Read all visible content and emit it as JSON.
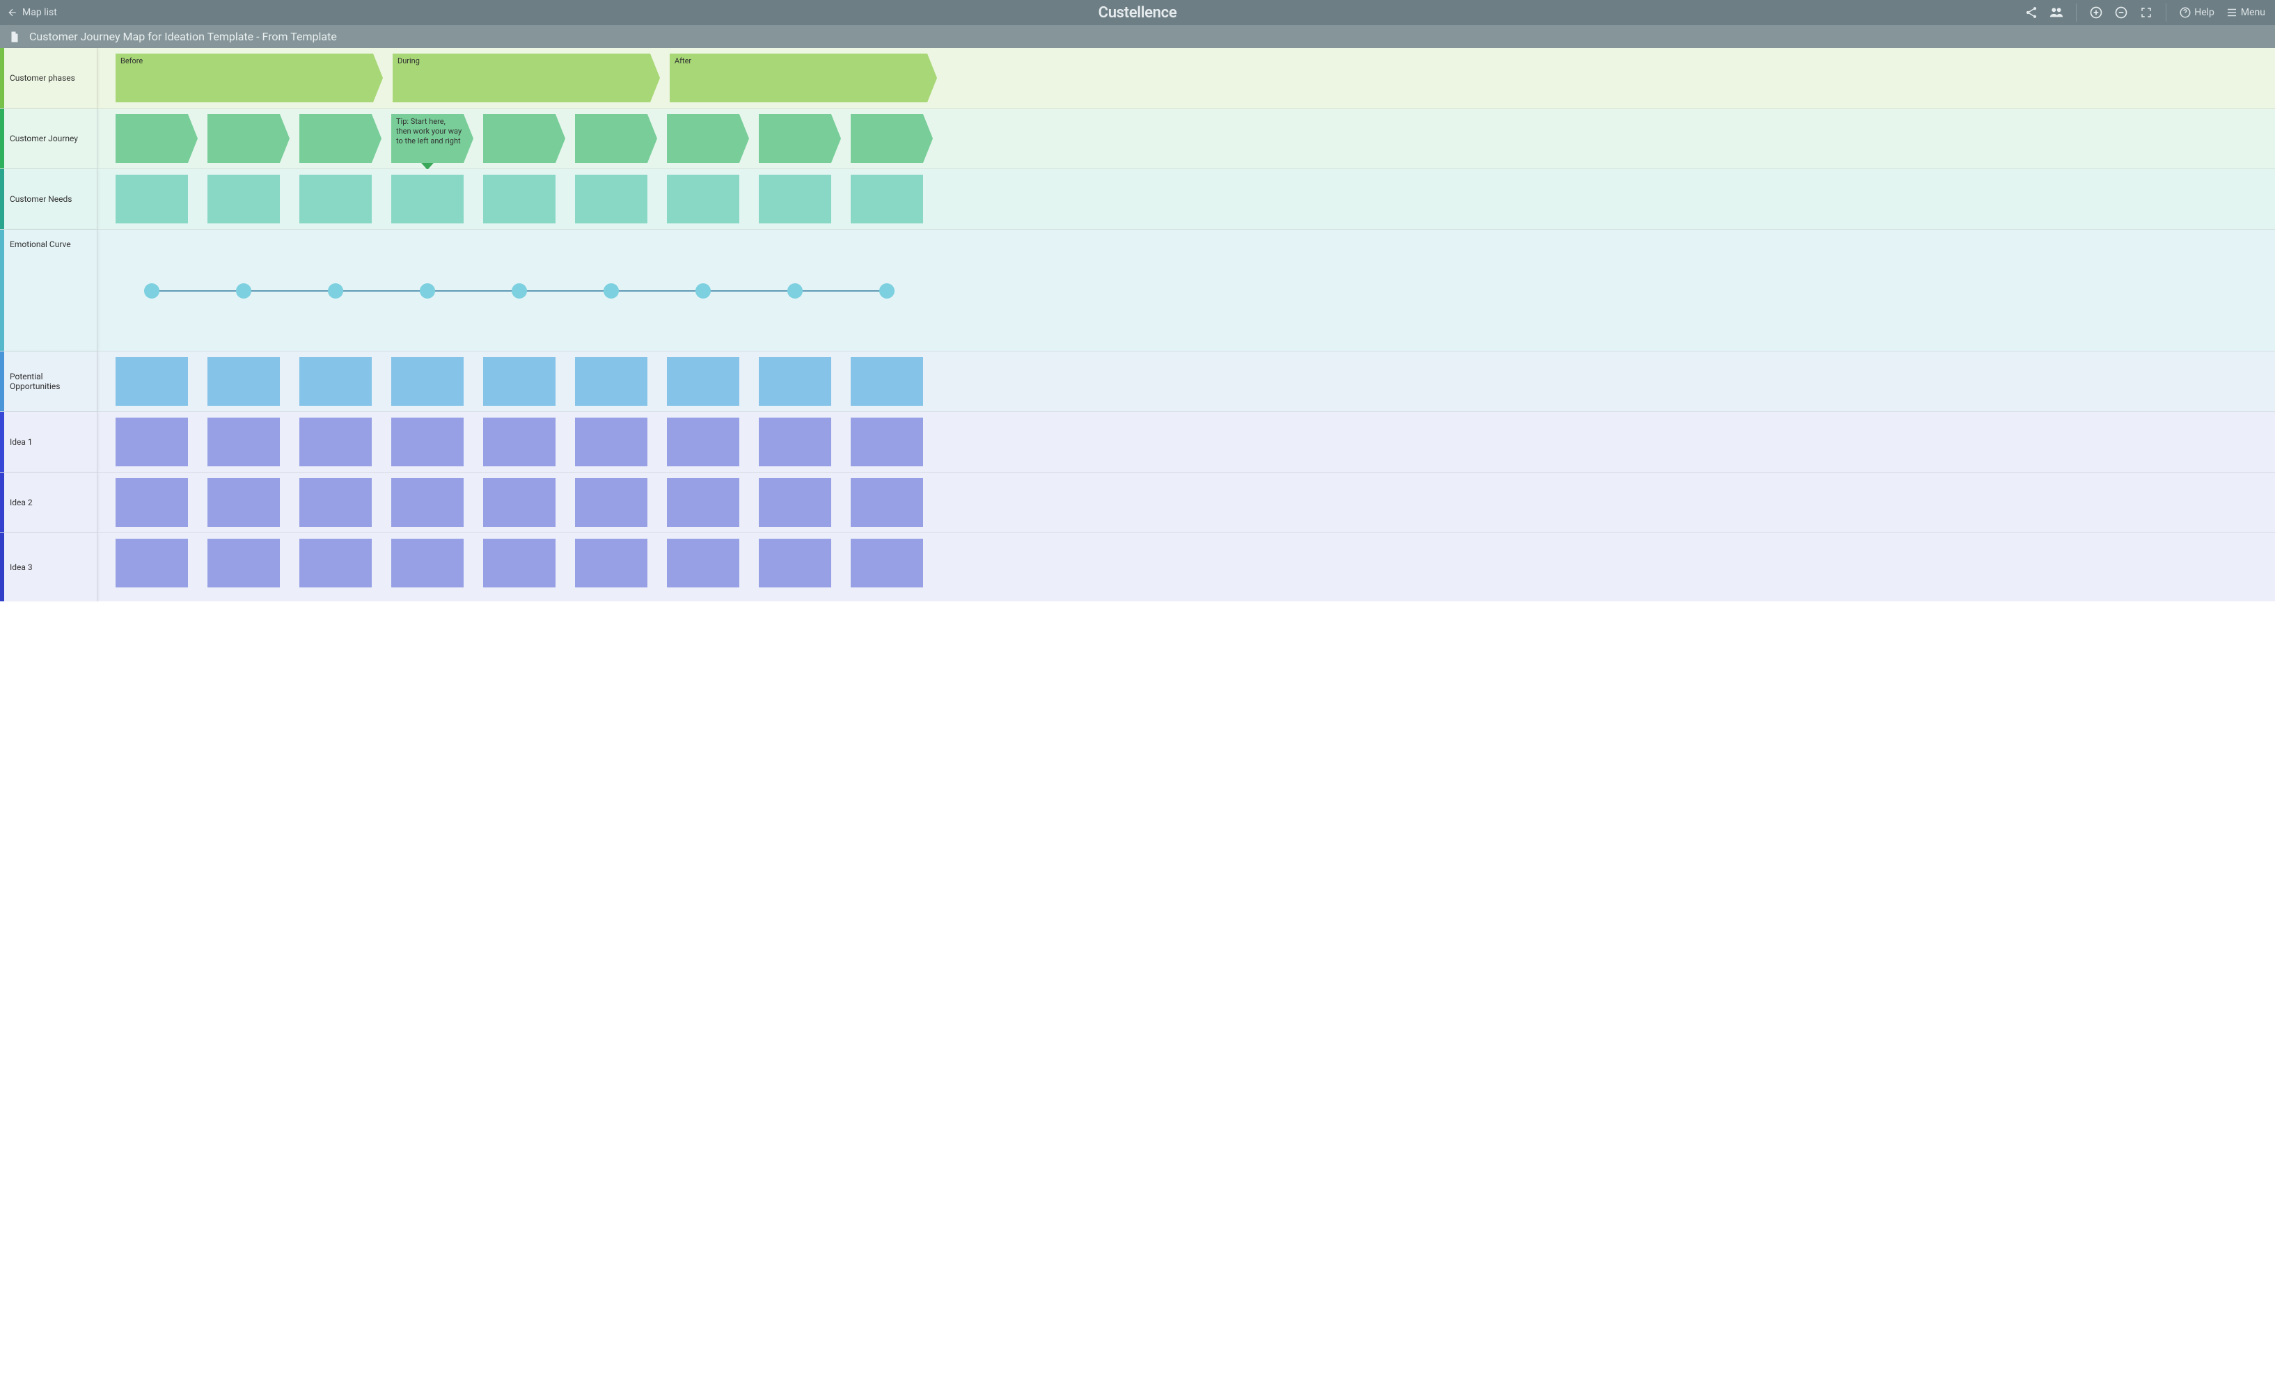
{
  "toolbar": {
    "map_list": "Map list",
    "logo": "Custellence",
    "help": "Help",
    "menu": "Menu"
  },
  "subheader": {
    "title": "Customer Journey Map for Ideation Template - From Template"
  },
  "phases": [
    "Before",
    "During",
    "After"
  ],
  "journey_tip": "Tip: Start here, then work your way to the left and right",
  "lanes": {
    "phases": "Customer phases",
    "journey": "Customer Journey",
    "needs": "Customer Needs",
    "curve": "Emotional Curve",
    "opps": "Potential Opportunities",
    "idea1": "Idea 1",
    "idea2": "Idea 2",
    "idea3": "Idea 3"
  },
  "column_count": 9
}
